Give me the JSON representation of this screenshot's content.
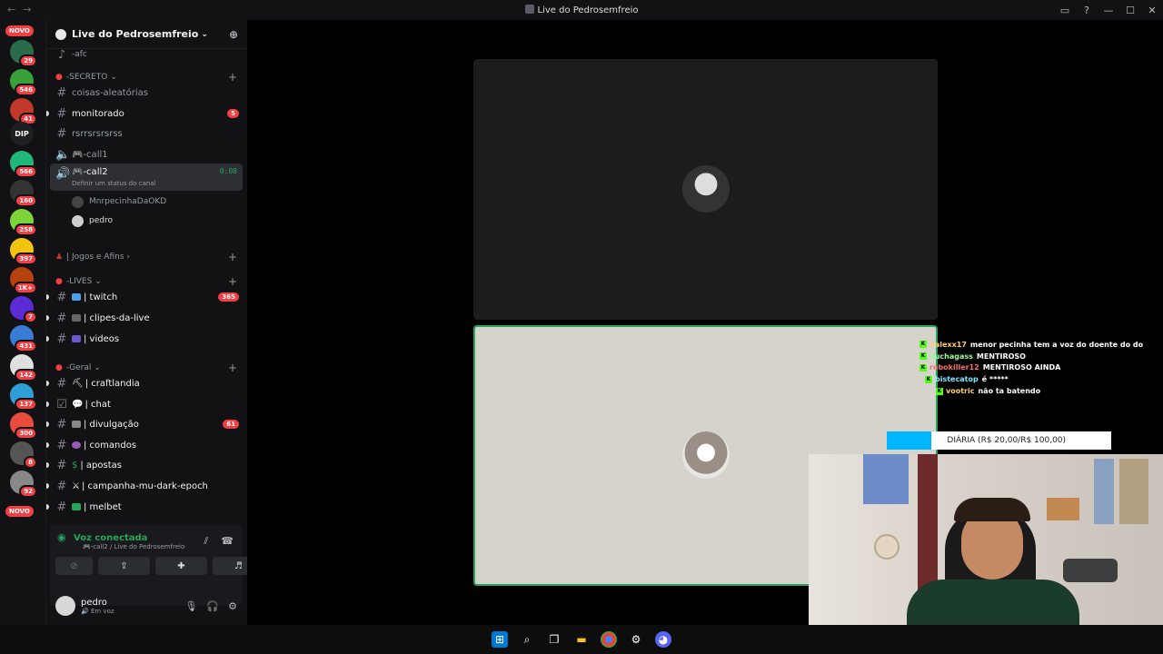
{
  "window": {
    "title": "Live do Pedrosemfreio",
    "back": "←",
    "forward": "→"
  },
  "servers": [
    {
      "badge": "NOVO",
      "color": "#f23f43",
      "kind": "novo"
    },
    {
      "badge": "29",
      "color": "#2a6b4a"
    },
    {
      "badge": "546",
      "color": "#3aa13a"
    },
    {
      "badge": "41",
      "color": "#c0392b"
    },
    {
      "badge": "",
      "color": "#1e1f22",
      "text": "DIP"
    },
    {
      "badge": "566",
      "color": "#1fb87a"
    },
    {
      "badge": "160",
      "color": "#333"
    },
    {
      "badge": "258",
      "color": "#7cd43a"
    },
    {
      "badge": "397",
      "color": "#f1c40f"
    },
    {
      "badge": "1K+",
      "color": "#b7410e"
    },
    {
      "badge": "7",
      "color": "#5b2bd6"
    },
    {
      "badge": "431",
      "color": "#3a7bd5"
    },
    {
      "badge": "142",
      "color": "#e0e0e0"
    },
    {
      "badge": "137",
      "color": "#2f9fd8"
    },
    {
      "badge": "300",
      "color": "#e74c3c"
    },
    {
      "badge": "8",
      "color": "#555"
    },
    {
      "badge": "92",
      "color": "#888"
    },
    {
      "badge": "NOVO",
      "color": "#f23f43",
      "kind": "novo"
    }
  ],
  "guild": {
    "name": "Live do Pedrosemfreio"
  },
  "categories": {
    "secreto": "SECRETO",
    "jogos": "| Jogos e Afins",
    "lives": "LIVES",
    "geral": "Geral"
  },
  "channels": {
    "top_partial": "-afc",
    "coisas": "coisas-aleatórias",
    "monitorado": "monitorado",
    "monitorado_mentions": "5",
    "rsrr": "rsrrsrsrsrss",
    "call1": "-call1",
    "call2": "-call2",
    "call2_timer": "0:08",
    "call2_status": "Definir um status do canal",
    "voice_user1": "MnrpecinhaDaOKD",
    "voice_user2": "pedro",
    "twitch": "| twitch",
    "twitch_mentions": "365",
    "clipes": "| clipes-da-live",
    "videos": "| videos",
    "craftlandia": "| craftlandia",
    "chat": "| chat",
    "divulgacao": "| divulgação",
    "divulgacao_mentions": "61",
    "comandos": "| comandos",
    "apostas": "| apostas",
    "campanha": "| campanha-mu-dark-epoch",
    "melbet": "| melbet"
  },
  "voice": {
    "status": "Voz conectada",
    "location": "-call2 / Live do Pedrosemfreio"
  },
  "user": {
    "name": "pedro",
    "status": "Em voz"
  },
  "overlay": {
    "chat": [
      {
        "user": "Calexx17",
        "msg": "menor pecinha tem a voz do doente do do",
        "color": "#ffcc66"
      },
      {
        "user": "duchagass",
        "msg": "MENTIROSO",
        "color": "#9ef7a0"
      },
      {
        "user": "robokiller12",
        "msg": "MENTIROSO AINDA",
        "color": "#ff6b6b"
      },
      {
        "user": "bistecatop",
        "msg": "é *****",
        "color": "#7fe7ff"
      },
      {
        "user": "vootric",
        "msg": "não ta batendo",
        "color": "#ffd36b"
      }
    ],
    "goal": "DIÁRIA (R$ 20,00/R$ 100,00)",
    "goal_progress": 0.2
  },
  "colors": {
    "accent_green": "#23a55a",
    "mention_red": "#f23f43",
    "bg": "#121214"
  }
}
